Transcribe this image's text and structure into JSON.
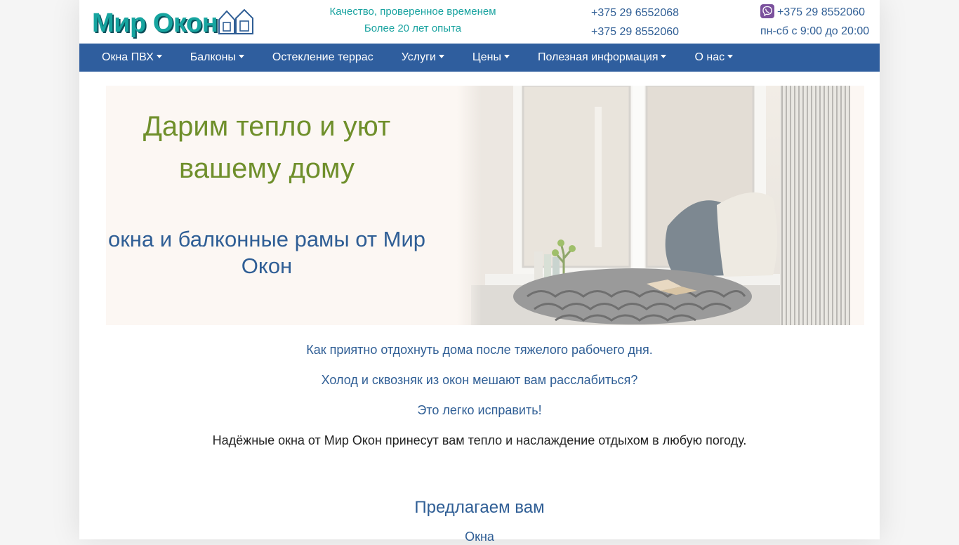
{
  "header": {
    "logo_text": "Мир Окон",
    "tagline_line1": "Качество, проверенное временем",
    "tagline_line2": "Более 20 лет опыта",
    "phone1": "+375 29 6552068",
    "phone2": "+375 29 8552060",
    "viber_phone": "+375 29 8552060",
    "hours": "пн-сб с 9:00 до 20:00"
  },
  "nav": {
    "items": [
      {
        "label": "Окна ПВХ"
      },
      {
        "label": "Балконы"
      },
      {
        "label": "Остекление террас"
      },
      {
        "label": "Услуги"
      },
      {
        "label": "Цены"
      },
      {
        "label": "Полезная информация"
      },
      {
        "label": "О нас"
      }
    ]
  },
  "hero": {
    "title": "Дарим тепло и уют вашему дому",
    "subtitle": "окна и балконные рамы от Мир Окон"
  },
  "intro": {
    "line1": "Как приятно отдохнуть дома после тяжелого рабочего дня.",
    "line2": "Холод и сквозняк из окон мешают вам расслабиться?",
    "line3": "Это легко исправить!",
    "line4": "Надёжные окна от Мир Окон принесут вам тепло и наслаждение отдыхом в любую погоду."
  },
  "offer": {
    "title": "Предлагаем вам",
    "first_link": "Окна"
  },
  "colors": {
    "nav_bg": "#2f5e9e",
    "accent_teal": "#1aa3a0",
    "accent_blue": "#2f5e95",
    "accent_green": "#6f8f2b",
    "hero_bg": "#fcf7f3"
  }
}
